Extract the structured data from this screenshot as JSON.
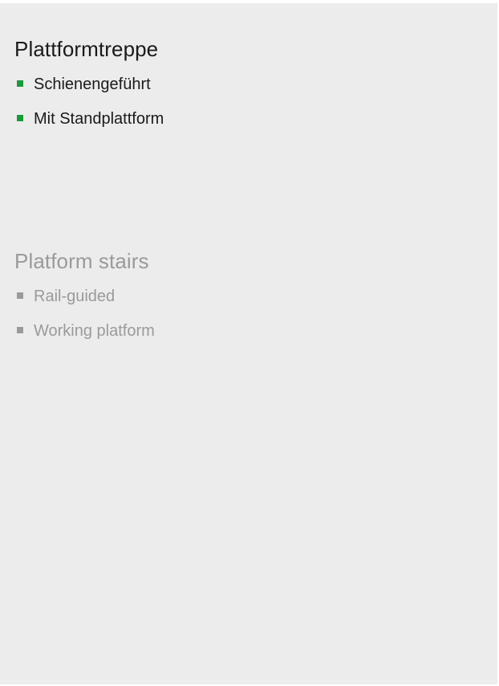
{
  "colors": {
    "background": "#ececec",
    "primary_text": "#1a1a1a",
    "secondary_text": "#9a9a9a",
    "accent_bullet": "#1a9a3a",
    "muted_bullet": "#9a9a9a"
  },
  "german": {
    "title": "Plattformtreppe",
    "features": [
      "Schienengeführt",
      "Mit Standplattform"
    ],
    "bullet_icon": "green-square-bullet"
  },
  "english": {
    "title": "Platform stairs",
    "features": [
      "Rail-guided",
      "Working platform"
    ],
    "bullet_icon": "grey-square-bullet"
  }
}
